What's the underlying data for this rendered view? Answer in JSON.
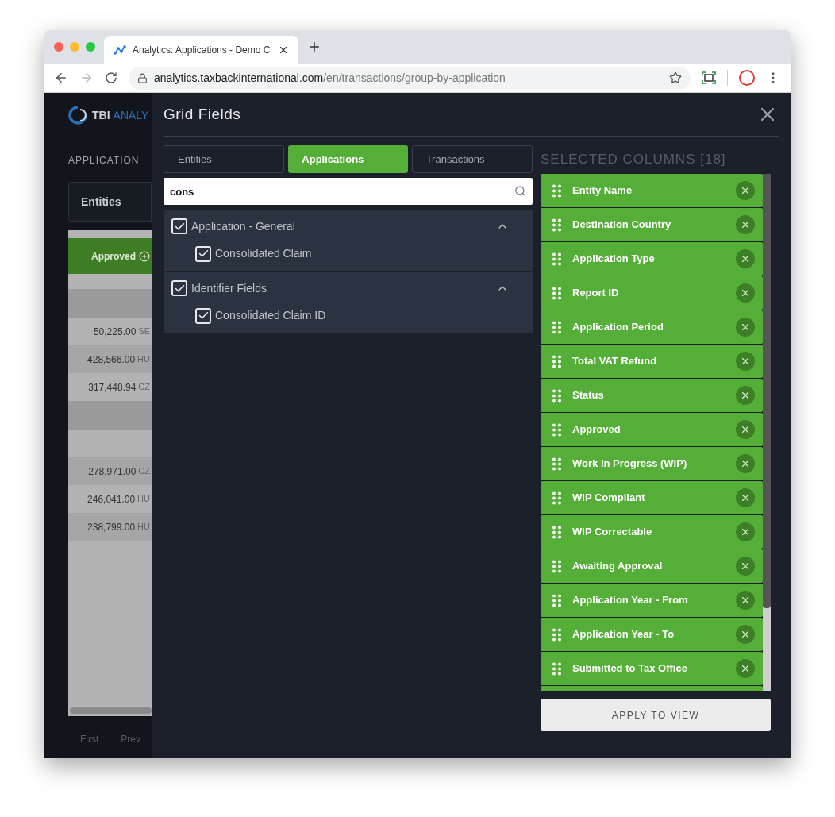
{
  "browser": {
    "tab_title": "Analytics: Applications - Demo C",
    "url_host": "analytics.taxbackinternational.com",
    "url_path": "/en/transactions/group-by-application"
  },
  "background": {
    "logo_main": "TBI",
    "logo_sub": "ANALY",
    "page_title": "APPLICATION",
    "filter_label": "Entities",
    "column_header": "Approved",
    "rows": [
      {
        "kind": "group"
      },
      {
        "kind": "data",
        "amount": "50,225.00",
        "currency": "SE"
      },
      {
        "kind": "data",
        "amount": "428,566.00",
        "currency": "HU"
      },
      {
        "kind": "data",
        "amount": "317,448.94",
        "currency": "CZ"
      },
      {
        "kind": "group"
      },
      {
        "kind": "empty"
      },
      {
        "kind": "data",
        "amount": "278,971.00",
        "currency": "CZ"
      },
      {
        "kind": "data",
        "amount": "246,041.00",
        "currency": "HU"
      },
      {
        "kind": "data",
        "amount": "238,799.00",
        "currency": "HU"
      }
    ],
    "pager": [
      "First",
      "Prev"
    ]
  },
  "dialog": {
    "title": "Grid Fields",
    "tabs": [
      {
        "label": "Entities",
        "selected": false
      },
      {
        "label": "Applications",
        "selected": true
      },
      {
        "label": "Transactions",
        "selected": false
      }
    ],
    "search": {
      "value": "cons"
    },
    "groups": [
      {
        "label": "Application - General",
        "checked": true,
        "expanded": true,
        "children": [
          {
            "label": "Consolidated Claim",
            "checked": true
          }
        ]
      },
      {
        "label": "Identifier Fields",
        "checked": true,
        "expanded": true,
        "children": [
          {
            "label": "Consolidated Claim ID",
            "checked": true
          }
        ]
      }
    ],
    "selected_heading": "SELECTED COLUMNS [18]",
    "selected_columns": [
      "Entity Name",
      "Destination Country",
      "Application Type",
      "Report ID",
      "Application Period",
      "Total VAT Refund",
      "Status",
      "Approved",
      "Work in Progress (WIP)",
      "WIP Compliant",
      "WIP Correctable",
      "Awaiting Approval",
      "Application Year - From",
      "Application Year - To",
      "Submitted to Tax Office"
    ],
    "apply_button": "APPLY TO VIEW"
  }
}
